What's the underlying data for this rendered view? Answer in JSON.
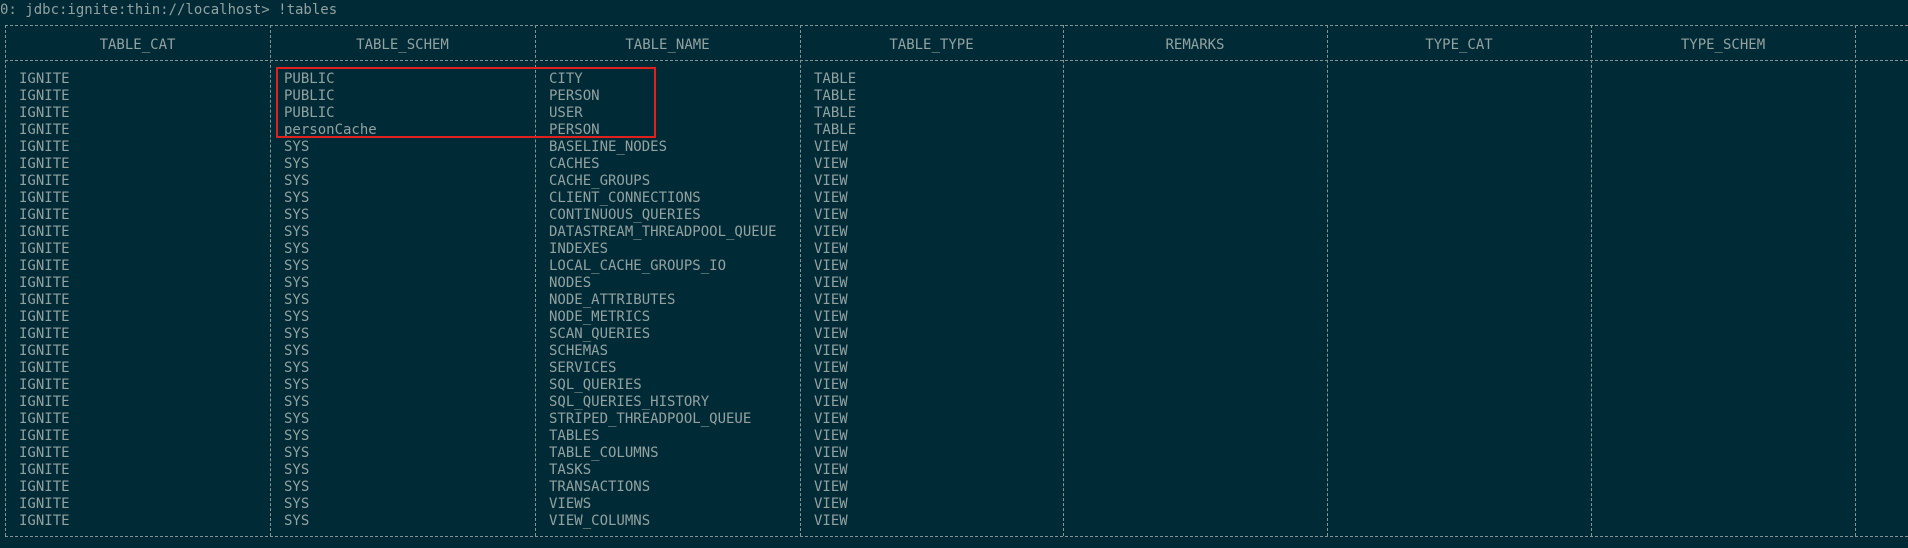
{
  "terminal": {
    "prompt": "0: jdbc:ignite:thin://localhost> !tables"
  },
  "table": {
    "columns": [
      "TABLE_CAT",
      "TABLE_SCHEM",
      "TABLE_NAME",
      "TABLE_TYPE",
      "REMARKS",
      "TYPE_CAT",
      "TYPE_SCHEM"
    ],
    "rows": [
      [
        "IGNITE",
        "PUBLIC",
        "CITY",
        "TABLE",
        "",
        "",
        ""
      ],
      [
        "IGNITE",
        "PUBLIC",
        "PERSON",
        "TABLE",
        "",
        "",
        ""
      ],
      [
        "IGNITE",
        "PUBLIC",
        "USER",
        "TABLE",
        "",
        "",
        ""
      ],
      [
        "IGNITE",
        "personCache",
        "PERSON",
        "TABLE",
        "",
        "",
        ""
      ],
      [
        "IGNITE",
        "SYS",
        "BASELINE_NODES",
        "VIEW",
        "",
        "",
        ""
      ],
      [
        "IGNITE",
        "SYS",
        "CACHES",
        "VIEW",
        "",
        "",
        ""
      ],
      [
        "IGNITE",
        "SYS",
        "CACHE_GROUPS",
        "VIEW",
        "",
        "",
        ""
      ],
      [
        "IGNITE",
        "SYS",
        "CLIENT_CONNECTIONS",
        "VIEW",
        "",
        "",
        ""
      ],
      [
        "IGNITE",
        "SYS",
        "CONTINUOUS_QUERIES",
        "VIEW",
        "",
        "",
        ""
      ],
      [
        "IGNITE",
        "SYS",
        "DATASTREAM_THREADPOOL_QUEUE",
        "VIEW",
        "",
        "",
        ""
      ],
      [
        "IGNITE",
        "SYS",
        "INDEXES",
        "VIEW",
        "",
        "",
        ""
      ],
      [
        "IGNITE",
        "SYS",
        "LOCAL_CACHE_GROUPS_IO",
        "VIEW",
        "",
        "",
        ""
      ],
      [
        "IGNITE",
        "SYS",
        "NODES",
        "VIEW",
        "",
        "",
        ""
      ],
      [
        "IGNITE",
        "SYS",
        "NODE_ATTRIBUTES",
        "VIEW",
        "",
        "",
        ""
      ],
      [
        "IGNITE",
        "SYS",
        "NODE_METRICS",
        "VIEW",
        "",
        "",
        ""
      ],
      [
        "IGNITE",
        "SYS",
        "SCAN_QUERIES",
        "VIEW",
        "",
        "",
        ""
      ],
      [
        "IGNITE",
        "SYS",
        "SCHEMAS",
        "VIEW",
        "",
        "",
        ""
      ],
      [
        "IGNITE",
        "SYS",
        "SERVICES",
        "VIEW",
        "",
        "",
        ""
      ],
      [
        "IGNITE",
        "SYS",
        "SQL_QUERIES",
        "VIEW",
        "",
        "",
        ""
      ],
      [
        "IGNITE",
        "SYS",
        "SQL_QUERIES_HISTORY",
        "VIEW",
        "",
        "",
        ""
      ],
      [
        "IGNITE",
        "SYS",
        "STRIPED_THREADPOOL_QUEUE",
        "VIEW",
        "",
        "",
        ""
      ],
      [
        "IGNITE",
        "SYS",
        "TABLES",
        "VIEW",
        "",
        "",
        ""
      ],
      [
        "IGNITE",
        "SYS",
        "TABLE_COLUMNS",
        "VIEW",
        "",
        "",
        ""
      ],
      [
        "IGNITE",
        "SYS",
        "TASKS",
        "VIEW",
        "",
        "",
        ""
      ],
      [
        "IGNITE",
        "SYS",
        "TRANSACTIONS",
        "VIEW",
        "",
        "",
        ""
      ],
      [
        "IGNITE",
        "SYS",
        "VIEWS",
        "VIEW",
        "",
        "",
        ""
      ],
      [
        "IGNITE",
        "SYS",
        "VIEW_COLUMNS",
        "VIEW",
        "",
        "",
        ""
      ]
    ]
  },
  "colors": {
    "background": "#002b36",
    "text": "#93a1a1",
    "annotation_box": "#e0201c"
  }
}
